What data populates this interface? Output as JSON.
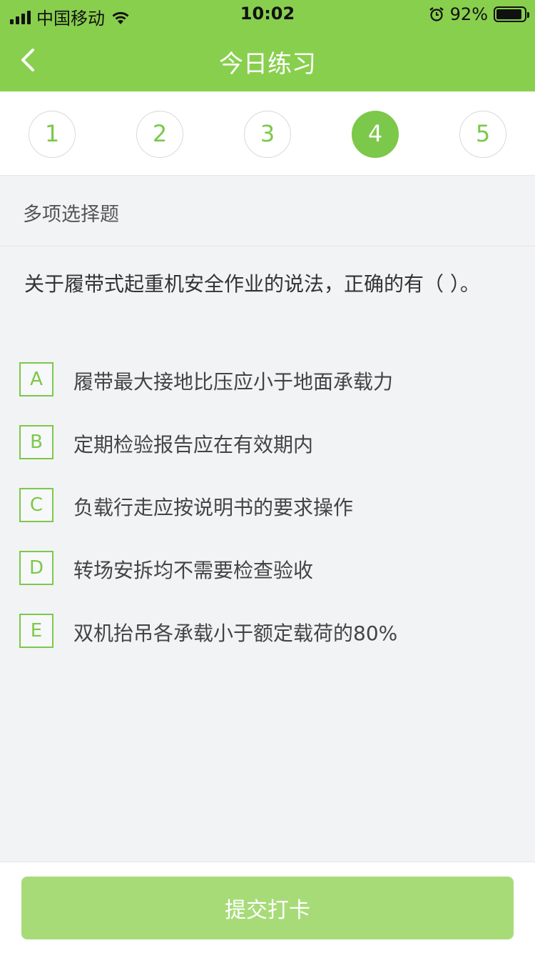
{
  "status_bar": {
    "carrier": "中国移动",
    "time": "10:02",
    "battery_percent": "92%",
    "battery_level": 0.92
  },
  "header": {
    "title": "今日练习"
  },
  "steps": [
    "1",
    "2",
    "3",
    "4",
    "5"
  ],
  "active_step": "4",
  "question_type": "多项选择题",
  "question_text": "关于履带式起重机安全作业的说法，正确的有（    ）。",
  "options": [
    {
      "letter": "A",
      "text": "履带最大接地比压应小于地面承载力"
    },
    {
      "letter": "B",
      "text": "定期检验报告应在有效期内"
    },
    {
      "letter": "C",
      "text": "负载行走应按说明书的要求操作"
    },
    {
      "letter": "D",
      "text": "转场安拆均不需要检查验收"
    },
    {
      "letter": "E",
      "text": "双机抬吊各承载小于额定载荷的80%"
    }
  ],
  "footer": {
    "submit_label": "提交打卡"
  },
  "colors": {
    "header": "#89cf4e",
    "accent": "#7cc84a",
    "submit_disabled": "#a7db78"
  }
}
